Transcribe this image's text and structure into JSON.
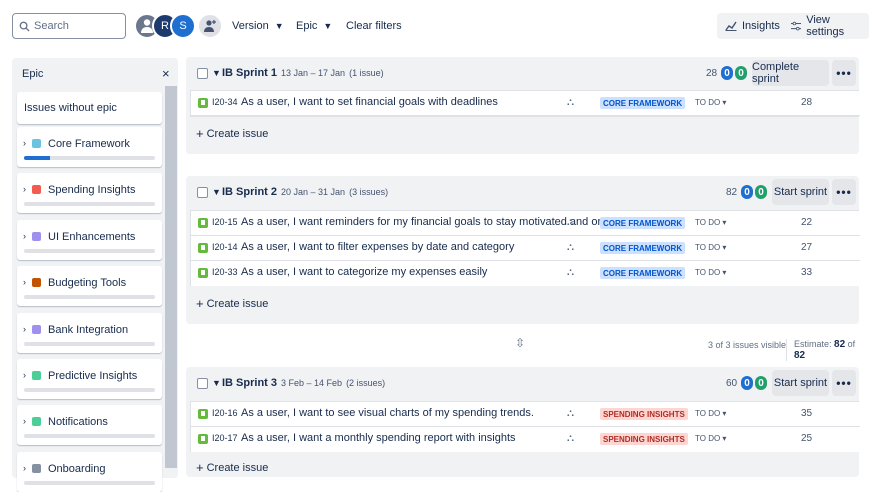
{
  "toolbar": {
    "search_placeholder": "Search",
    "avatars": [
      "",
      "R",
      "S"
    ],
    "version_label": "Version",
    "epic_label": "Epic",
    "clear_filters": "Clear filters",
    "insights_label": "Insights",
    "view_settings_label": "View settings"
  },
  "epic_panel": {
    "title": "Epic",
    "close": "×",
    "without_epic": "Issues without epic",
    "epics": [
      {
        "name": "Core Framework",
        "color": "#6cc3e0",
        "progress": 0.2
      },
      {
        "name": "Spending Insights",
        "color": "#f15b50",
        "progress": 0
      },
      {
        "name": "UI Enhancements",
        "color": "#9f8fef",
        "progress": 0
      },
      {
        "name": "Budgeting Tools",
        "color": "#c25100",
        "progress": 0
      },
      {
        "name": "Bank Integration",
        "color": "#9f8fef",
        "progress": 0
      },
      {
        "name": "Predictive Insights",
        "color": "#4bce97",
        "progress": 0
      },
      {
        "name": "Notifications",
        "color": "#4bce97",
        "progress": 0
      },
      {
        "name": "Onboarding",
        "color": "#8590a2",
        "progress": 0
      }
    ]
  },
  "sprints": [
    {
      "name": "IB Sprint 1",
      "dates": "13 Jan – 17 Jan",
      "count": "(1 issue)",
      "estimate": "28",
      "pill_blue": "0",
      "pill_green": "0",
      "action": "Complete sprint",
      "issues": [
        {
          "key": "I20-34",
          "summary": "As a user, I want to set financial goals with deadlines",
          "epic": "CORE FRAMEWORK",
          "status": "TO DO",
          "points": "28"
        }
      ]
    },
    {
      "name": "IB Sprint 2",
      "dates": "20 Jan – 31 Jan",
      "count": "(3 issues)",
      "estimate": "82",
      "pill_blue": "0",
      "pill_green": "0",
      "action": "Start sprint",
      "issues": [
        {
          "key": "I20-15",
          "summary": "As a user, I want reminders for my financial goals to stay motivated and on track",
          "epic": "CORE FRAMEWORK",
          "status": "TO DO",
          "points": "22"
        },
        {
          "key": "I20-14",
          "summary": "As a user, I want to filter expenses by date and category",
          "epic": "CORE FRAMEWORK",
          "status": "TO DO",
          "points": "27"
        },
        {
          "key": "I20-33",
          "summary": "As a user, I want to categorize my expenses easily",
          "epic": "CORE FRAMEWORK",
          "status": "TO DO",
          "points": "33"
        }
      ],
      "visible": "3 of 3 issues visible",
      "estimate_label": "Estimate:",
      "estimate_value": "82",
      "estimate_of": "of",
      "estimate_total": "82"
    },
    {
      "name": "IB Sprint 3",
      "dates": "3 Feb – 14 Feb",
      "count": "(2 issues)",
      "estimate": "60",
      "pill_blue": "0",
      "pill_green": "0",
      "action": "Start sprint",
      "issues": [
        {
          "key": "I20-16",
          "summary": "As a user, I want to see visual charts of my spending trends.",
          "epic": "SPENDING INSIGHTS",
          "status": "TO DO",
          "points": "35"
        },
        {
          "key": "I20-17",
          "summary": "As a user, I want a monthly spending report with insights",
          "epic": "SPENDING INSIGHTS",
          "status": "TO DO",
          "points": "25"
        }
      ]
    }
  ],
  "create_issue": "Create issue",
  "more": "•••"
}
